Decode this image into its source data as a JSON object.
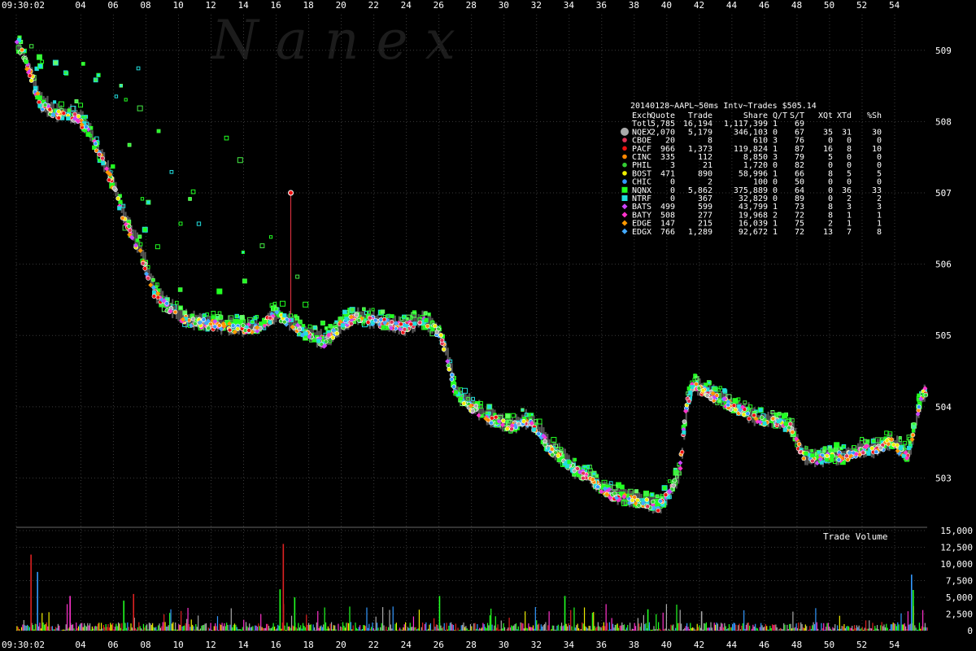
{
  "watermark": "N a n e x",
  "chart_data": [
    {
      "type": "scatter",
      "title": "20140128~AAPL~50ms Intv~Trades $505.14",
      "x_start": "09:30:02",
      "x_ticks": [
        "09:30:02",
        "04",
        "06",
        "08",
        "10",
        "12",
        "14",
        "16",
        "18",
        "20",
        "22",
        "24",
        "26",
        "28",
        "30",
        "32",
        "34",
        "36",
        "38",
        "40",
        "42",
        "44",
        "46",
        "48",
        "50",
        "52",
        "54"
      ],
      "x_tick_minutes": [
        30.033,
        34,
        36,
        38,
        40,
        42,
        44,
        46,
        48,
        50,
        52,
        54,
        56,
        58,
        60,
        62,
        64,
        66,
        68,
        70,
        72,
        74,
        76,
        78,
        80,
        82,
        84
      ],
      "xlim_minutes": [
        30.033,
        86.0
      ],
      "y_ticks": [
        "509",
        "508",
        "507",
        "506",
        "505",
        "504",
        "503"
      ],
      "ylim": [
        502.4,
        509.5
      ],
      "grid": true,
      "price_path": {
        "x_minutes": [
          30.033,
          30.5,
          31.0,
          31.5,
          32.5,
          33.2,
          33.8,
          34.5,
          35.2,
          36.0,
          36.7,
          37.6,
          38.5,
          39.3,
          40.5,
          42.0,
          43.5,
          45.0,
          46.0,
          47.0,
          48.0,
          49.0,
          50.0,
          51.0,
          52.0,
          53.0,
          53.8,
          54.3,
          54.9,
          56.0,
          56.5,
          57.0,
          58.0,
          58.9,
          59.5,
          60.3,
          61.3,
          62.0,
          62.8,
          63.5,
          64.3,
          65.2,
          66.0,
          66.7,
          67.5,
          68.5,
          69.5,
          70.1,
          70.8,
          71.2,
          71.6,
          72.4,
          73.3,
          74.0,
          74.6,
          75.6,
          76.5,
          77.6,
          78.4,
          79.2,
          80.0,
          81.0,
          82.0,
          82.8,
          83.8,
          84.8,
          85.6,
          86.0
        ],
        "price": [
          509.1,
          508.9,
          508.6,
          508.25,
          508.1,
          508.1,
          508.05,
          507.85,
          507.5,
          507.1,
          506.6,
          506.2,
          505.6,
          505.4,
          505.2,
          505.15,
          505.1,
          505.1,
          505.3,
          505.15,
          505.0,
          504.9,
          505.15,
          505.25,
          505.2,
          505.15,
          505.1,
          505.15,
          505.2,
          505.05,
          504.7,
          504.2,
          504.0,
          503.85,
          503.8,
          503.7,
          503.8,
          503.7,
          503.4,
          503.3,
          503.1,
          503.0,
          502.85,
          502.75,
          502.7,
          502.65,
          502.6,
          502.75,
          503.1,
          504.0,
          504.3,
          504.2,
          504.1,
          504.0,
          503.95,
          503.8,
          503.8,
          503.7,
          503.3,
          503.25,
          503.3,
          503.3,
          503.4,
          503.4,
          503.5,
          503.3,
          504.1,
          504.25
        ]
      },
      "legend": {
        "columns": [
          "Exch",
          "Quote",
          "Trade",
          "Share",
          "Q/T",
          "S/T",
          "XQt",
          "XTd",
          "%Sh"
        ],
        "total": {
          "label": "Totl",
          "quote": "5,785",
          "trade": "16,194",
          "share": "1,117,399",
          "qt": "1",
          "st": "69"
        },
        "rows": [
          {
            "exch": "NQEX",
            "quote": "2,070",
            "trade": "5,179",
            "share": "346,103",
            "qt": "0",
            "st": "67",
            "xqt": "35",
            "xtd": "31",
            "sh": "30",
            "color": "#aaaaaa",
            "marker": "circle"
          },
          {
            "exch": "CBOE",
            "quote": "20",
            "trade": "8",
            "share": "610",
            "qt": "3",
            "st": "76",
            "xqt": "0",
            "xtd": "0",
            "sh": "0",
            "color": "#dd3355",
            "marker": "circle"
          },
          {
            "exch": "PACF",
            "quote": "966",
            "trade": "1,373",
            "share": "119,824",
            "qt": "1",
            "st": "87",
            "xqt": "16",
            "xtd": "8",
            "sh": "10",
            "color": "#ee1111",
            "marker": "circle"
          },
          {
            "exch": "CINC",
            "quote": "335",
            "trade": "112",
            "share": "8,850",
            "qt": "3",
            "st": "79",
            "xqt": "5",
            "xtd": "0",
            "sh": "0",
            "color": "#ff8800",
            "marker": "circle"
          },
          {
            "exch": "PHIL",
            "quote": "3",
            "trade": "21",
            "share": "1,720",
            "qt": "0",
            "st": "82",
            "xqt": "0",
            "xtd": "0",
            "sh": "0",
            "color": "#33cc33",
            "marker": "circle"
          },
          {
            "exch": "BOST",
            "quote": "471",
            "trade": "890",
            "share": "58,996",
            "qt": "1",
            "st": "66",
            "xqt": "8",
            "xtd": "5",
            "sh": "5",
            "color": "#eeee00",
            "marker": "circle"
          },
          {
            "exch": "CHIC",
            "quote": "0",
            "trade": "2",
            "share": "100",
            "qt": "0",
            "st": "50",
            "xqt": "0",
            "xtd": "0",
            "sh": "0",
            "color": "#3399ff",
            "marker": "circle"
          },
          {
            "exch": "NQNX",
            "quote": "0",
            "trade": "5,862",
            "share": "375,889",
            "qt": "0",
            "st": "64",
            "xqt": "0",
            "xtd": "36",
            "sh": "33",
            "color": "#22ff22",
            "marker": "square"
          },
          {
            "exch": "NTRF",
            "quote": "0",
            "trade": "367",
            "share": "32,829",
            "qt": "0",
            "st": "89",
            "xqt": "0",
            "xtd": "2",
            "sh": "2",
            "color": "#22dddd",
            "marker": "square"
          },
          {
            "exch": "BATS",
            "quote": "499",
            "trade": "599",
            "share": "43,799",
            "qt": "1",
            "st": "73",
            "xqt": "8",
            "xtd": "3",
            "sh": "3",
            "color": "#cc44ff",
            "marker": "diamond"
          },
          {
            "exch": "BATY",
            "quote": "508",
            "trade": "277",
            "share": "19,968",
            "qt": "2",
            "st": "72",
            "xqt": "8",
            "xtd": "1",
            "sh": "1",
            "color": "#ff33cc",
            "marker": "diamond"
          },
          {
            "exch": "EDGE",
            "quote": "147",
            "trade": "215",
            "share": "16,039",
            "qt": "1",
            "st": "75",
            "xqt": "2",
            "xtd": "1",
            "sh": "1",
            "color": "#ff9900",
            "marker": "diamond"
          },
          {
            "exch": "EDGX",
            "quote": "766",
            "trade": "1,289",
            "share": "92,672",
            "qt": "1",
            "st": "72",
            "xqt": "13",
            "xtd": "7",
            "sh": "8",
            "color": "#44aaff",
            "marker": "diamond"
          }
        ]
      }
    },
    {
      "type": "bar",
      "title": "Trade Volume",
      "y_ticks": [
        "15,000",
        "12,500",
        "10,000",
        "7,500",
        "5,000",
        "2,500",
        "0"
      ],
      "ylim": [
        0,
        15000
      ],
      "spikes": [
        {
          "minute": 30.9,
          "value": 11400,
          "color": "#dd2222"
        },
        {
          "minute": 31.3,
          "value": 8800,
          "color": "#3399ff"
        },
        {
          "minute": 33.3,
          "value": 5200,
          "color": "#ff33cc"
        },
        {
          "minute": 36.6,
          "value": 4500,
          "color": "#22ff22"
        },
        {
          "minute": 37.2,
          "value": 5500,
          "color": "#dd2222"
        },
        {
          "minute": 46.2,
          "value": 6200,
          "color": "#22ff22"
        },
        {
          "minute": 46.4,
          "value": 13000,
          "color": "#dd2222"
        },
        {
          "minute": 47.1,
          "value": 5000,
          "color": "#22ff22"
        },
        {
          "minute": 56.0,
          "value": 5200,
          "color": "#22ff22"
        },
        {
          "minute": 63.7,
          "value": 5200,
          "color": "#22ff22"
        },
        {
          "minute": 68.8,
          "value": 3200,
          "color": "#22ff22"
        },
        {
          "minute": 72.1,
          "value": 2900,
          "color": "#aaaaaa"
        },
        {
          "minute": 85.0,
          "value": 8400,
          "color": "#3399ff"
        },
        {
          "minute": 85.1,
          "value": 6100,
          "color": "#22ff22"
        }
      ]
    }
  ],
  "colors": {
    "background": "#000000",
    "grid": "#3a3a3a",
    "qnx": "#22ff22",
    "spread": "#555555",
    "text": "#ffffff"
  }
}
